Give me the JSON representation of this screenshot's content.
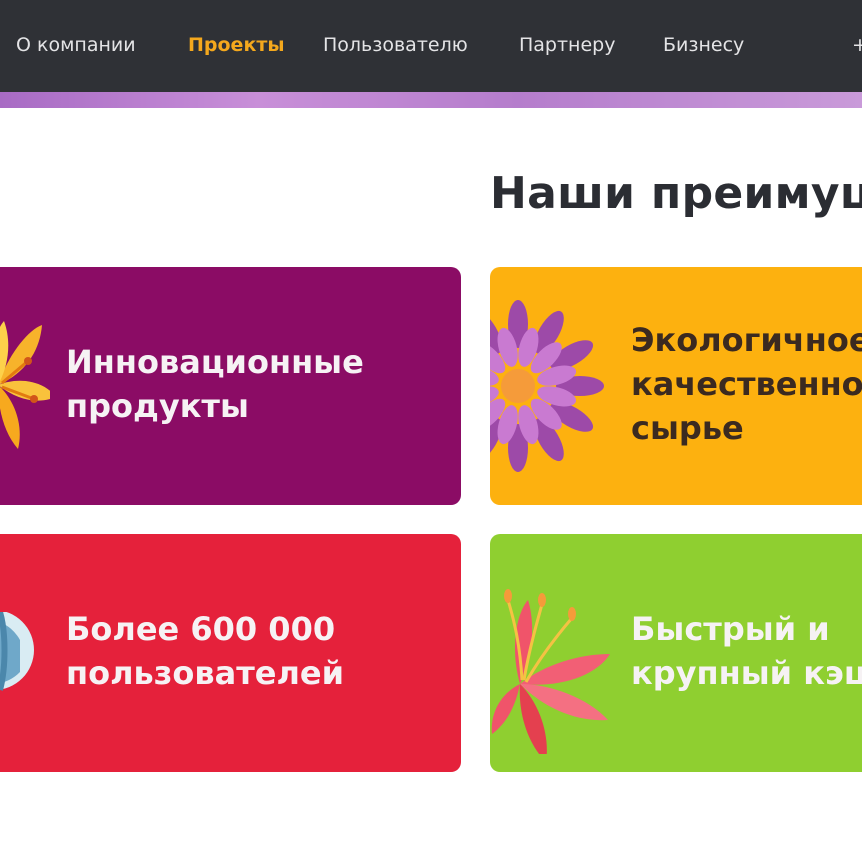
{
  "nav": {
    "items": [
      {
        "label": "О компании",
        "active": false
      },
      {
        "label": "Проекты",
        "active": true
      },
      {
        "label": "Пользователю",
        "active": false
      },
      {
        "label": "Партнеру",
        "active": false
      },
      {
        "label": "Бизнесу",
        "active": false
      }
    ],
    "more": "+"
  },
  "section": {
    "title": "Наши преимущ"
  },
  "cards": [
    {
      "line1": "Инновационные",
      "line2": "продукты",
      "line3": "",
      "color": "#8b0c65",
      "icon": "lily-flower-icon"
    },
    {
      "line1": "Экологичное",
      "line2": "качественно",
      "line3": "сырье",
      "color": "#fdb10f",
      "icon": "aster-flower-icon"
    },
    {
      "line1": "Более 600 000",
      "line2": "пользователей",
      "line3": "",
      "color": "#e5213b",
      "icon": "globe-icon"
    },
    {
      "line1": "Быстрый и",
      "line2": "крупный кэш",
      "line3": "",
      "color": "#8fcf30",
      "icon": "red-lily-icon"
    }
  ],
  "colors": {
    "nav_bg": "#2f3136",
    "nav_active": "#f4a81d",
    "accent_strip": "#b57dcc"
  }
}
